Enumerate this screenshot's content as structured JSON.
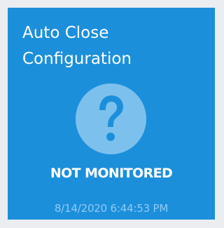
{
  "tile": {
    "title_line1": "Auto Close",
    "title_line2": "Configuration",
    "icon": "question-mark-icon",
    "status": "NOT MONITORED",
    "timestamp": "8/14/2020 6:44:53 PM"
  },
  "colors": {
    "page_background": "#ebedf1",
    "tile_background": "#1c8fdb",
    "icon_circle": "#7cc1ee",
    "icon_glyph": "#1c8fdb",
    "text": "#ffffff",
    "timestamp_text": "#8fcaf3"
  }
}
